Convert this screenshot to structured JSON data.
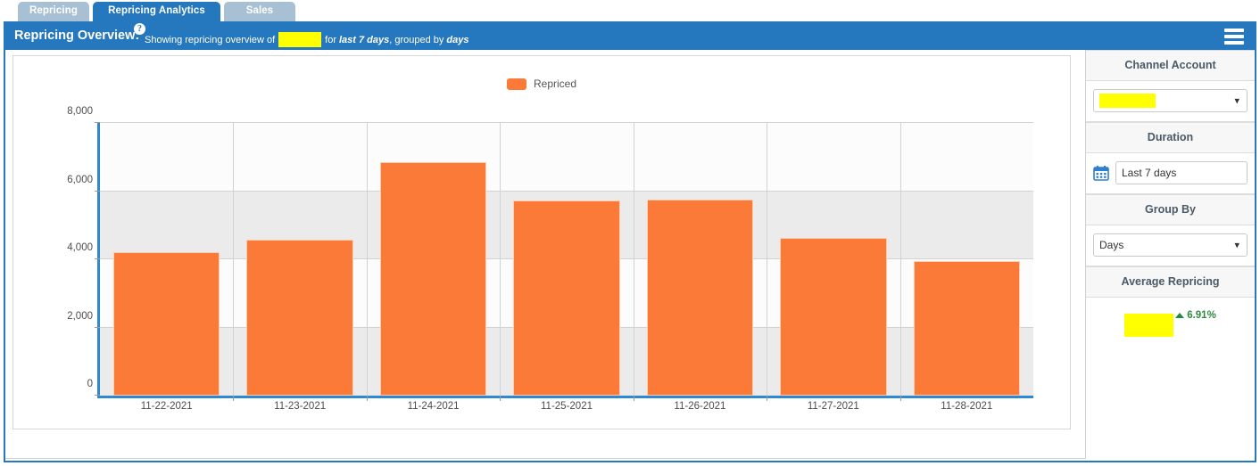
{
  "tabs": [
    {
      "label": "Repricing",
      "active": false
    },
    {
      "label": "Repricing Analytics",
      "active": true
    },
    {
      "label": "Sales",
      "active": false
    }
  ],
  "header": {
    "title": "Repricing Overview:",
    "help_icon": "question-mark-icon",
    "sub_prefix": "Showing repricing overview of",
    "sub_redacted_account": "",
    "sub_for": "for",
    "sub_duration": "last 7 days",
    "sub_grouped": ", grouped by",
    "sub_group": "days",
    "menu_icon": "hamburger-menu-icon",
    "background": "#2578bd"
  },
  "sidebar": {
    "channel_account": {
      "heading": "Channel Account",
      "value": "",
      "caret_icon": "chevron-down-icon"
    },
    "duration": {
      "heading": "Duration",
      "calendar_icon": "calendar-icon",
      "value": "Last 7 days"
    },
    "group_by": {
      "heading": "Group By",
      "value": "Days",
      "caret_icon": "chevron-down-icon"
    },
    "average_repricing": {
      "heading": "Average Repricing",
      "value": "",
      "delta_icon": "triangle-up-icon",
      "delta": "6.91%",
      "delta_color": "#2e8b3e"
    }
  },
  "chart_data": {
    "type": "bar",
    "title": "",
    "xlabel": "",
    "ylabel": "",
    "ylim": [
      0,
      8000
    ],
    "ytick_labels": [
      "0",
      "2,000",
      "4,000",
      "6,000",
      "8,000"
    ],
    "ytick_values": [
      0,
      2000,
      4000,
      6000,
      8000
    ],
    "grid": true,
    "legend_position": "top-center",
    "legend": [
      "Repriced"
    ],
    "series_color": "#fb7a37",
    "categories": [
      "11-22-2021",
      "11-23-2021",
      "11-24-2021",
      "11-25-2021",
      "11-26-2021",
      "11-27-2021",
      "11-28-2021"
    ],
    "series": [
      {
        "name": "Repriced",
        "values": [
          4210,
          4580,
          6860,
          5730,
          5760,
          4630,
          3950
        ]
      }
    ]
  }
}
